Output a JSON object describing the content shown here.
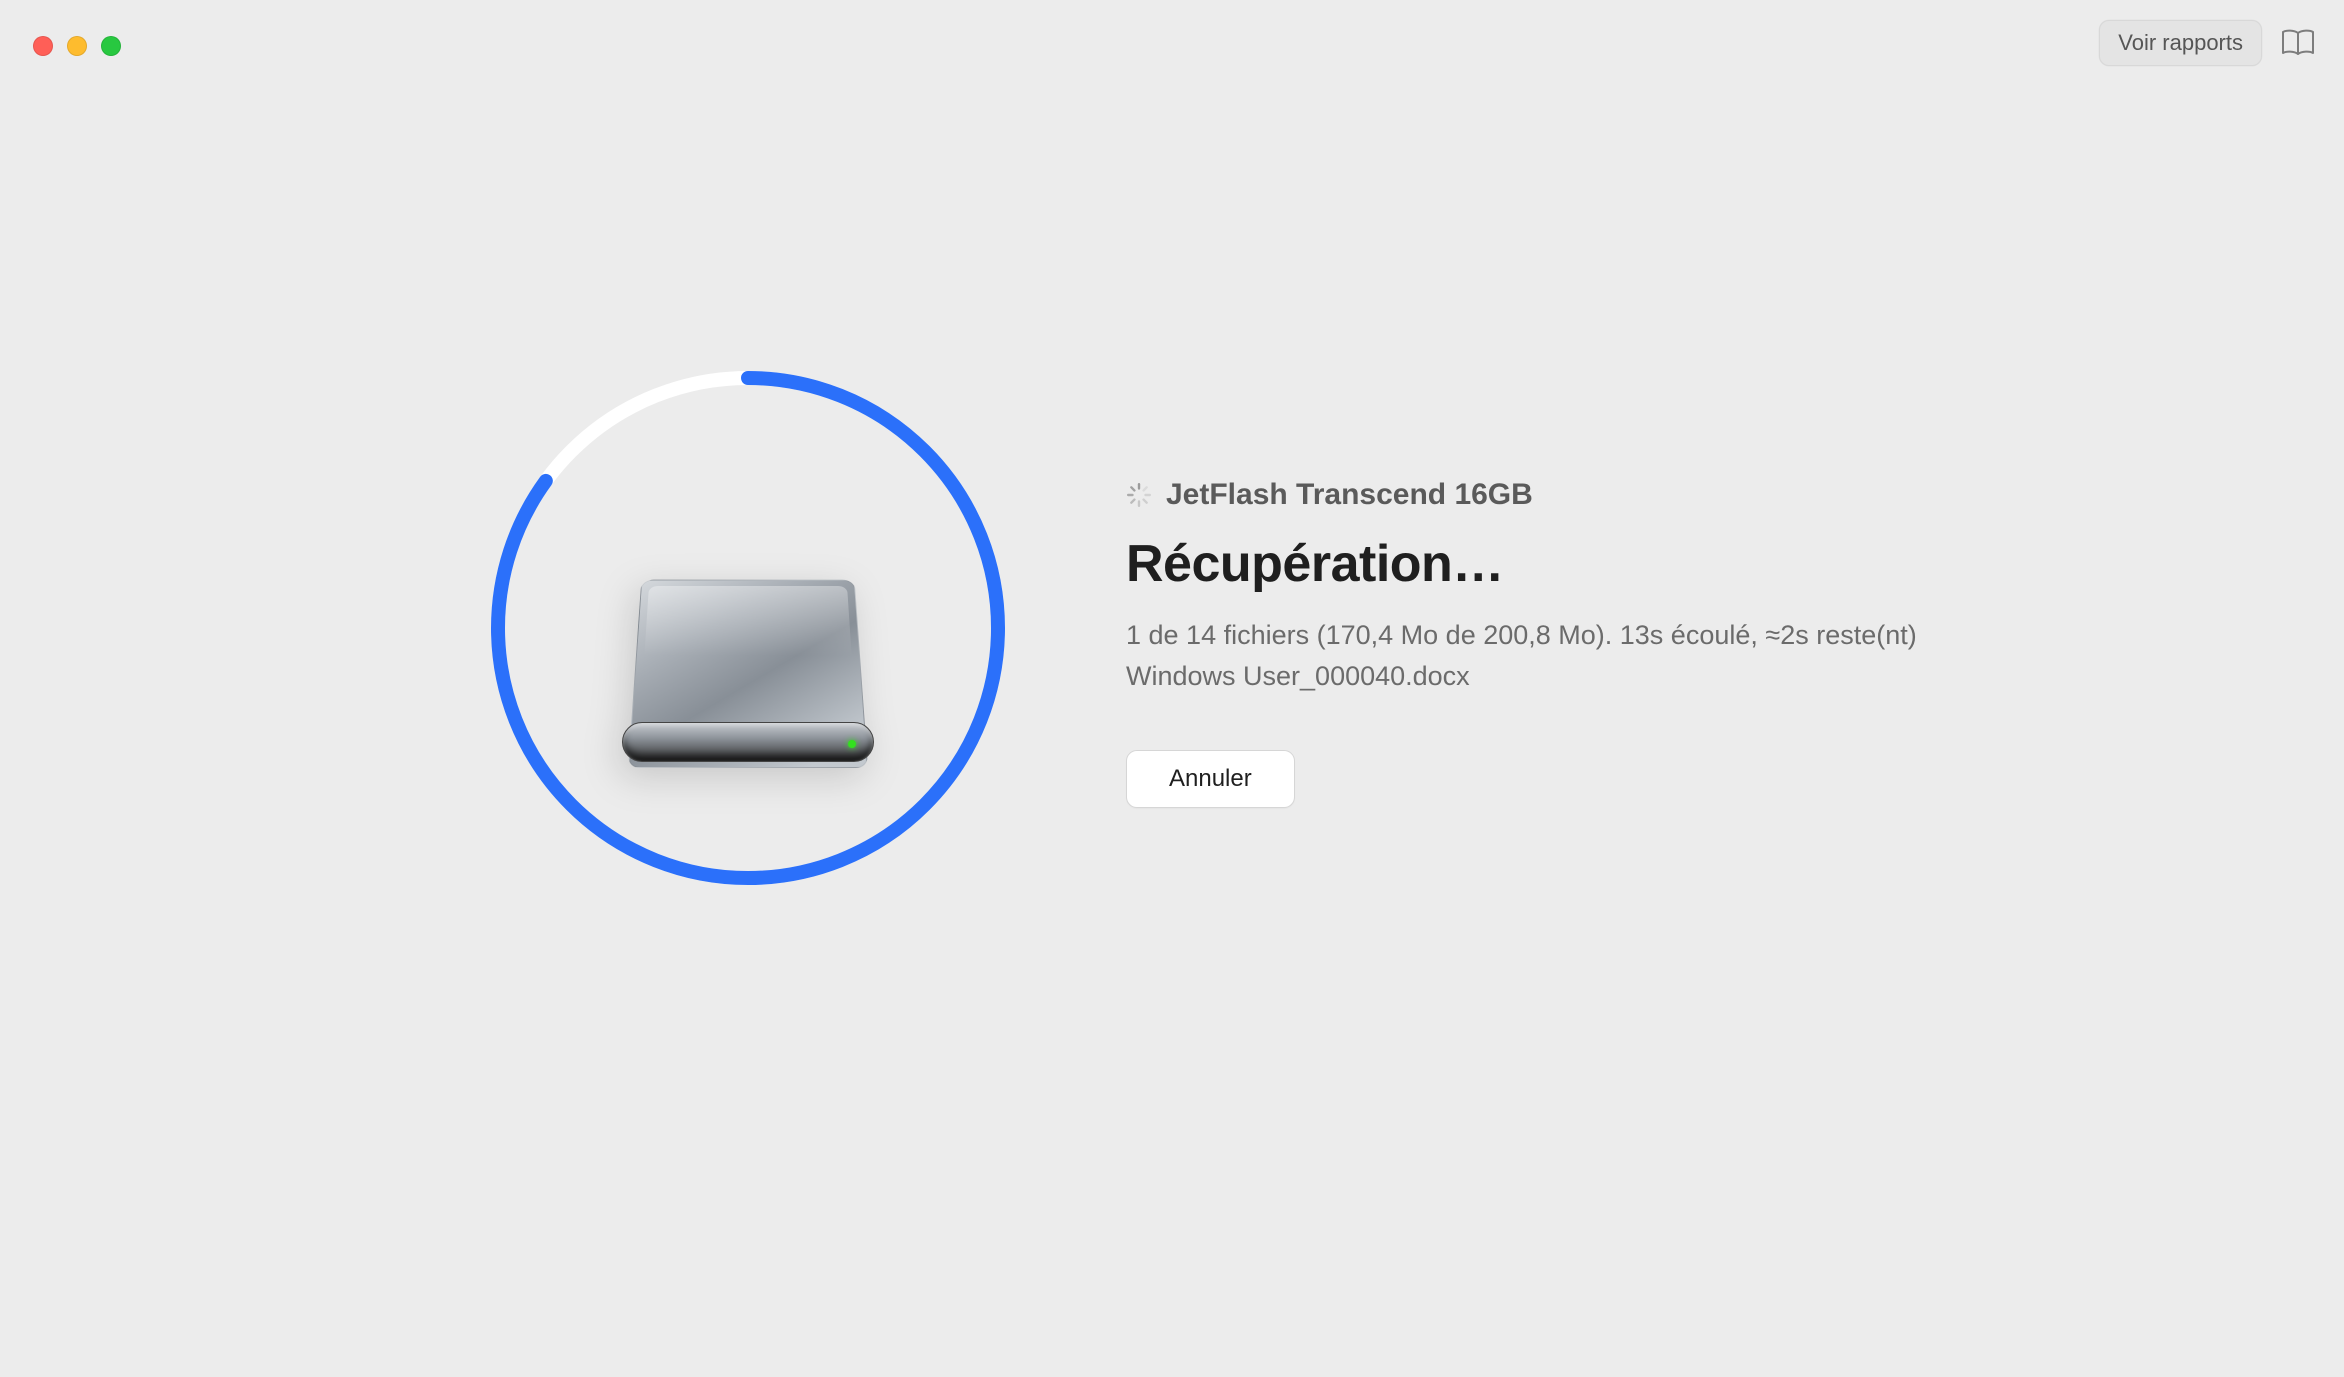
{
  "toolbar": {
    "reports_label": "Voir rapports"
  },
  "device": {
    "name": "JetFlash Transcend 16GB"
  },
  "operation": {
    "title": "Récupération…",
    "status_line": "1 de 14 fichiers (170,4 Mo de 200,8 Mo). 13s écoulé, ≈2s reste(nt)",
    "current_file": "Windows User_000040.docx",
    "cancel_label": "Annuler",
    "progress_percent": 85
  },
  "colors": {
    "accent": "#2b70fa"
  }
}
